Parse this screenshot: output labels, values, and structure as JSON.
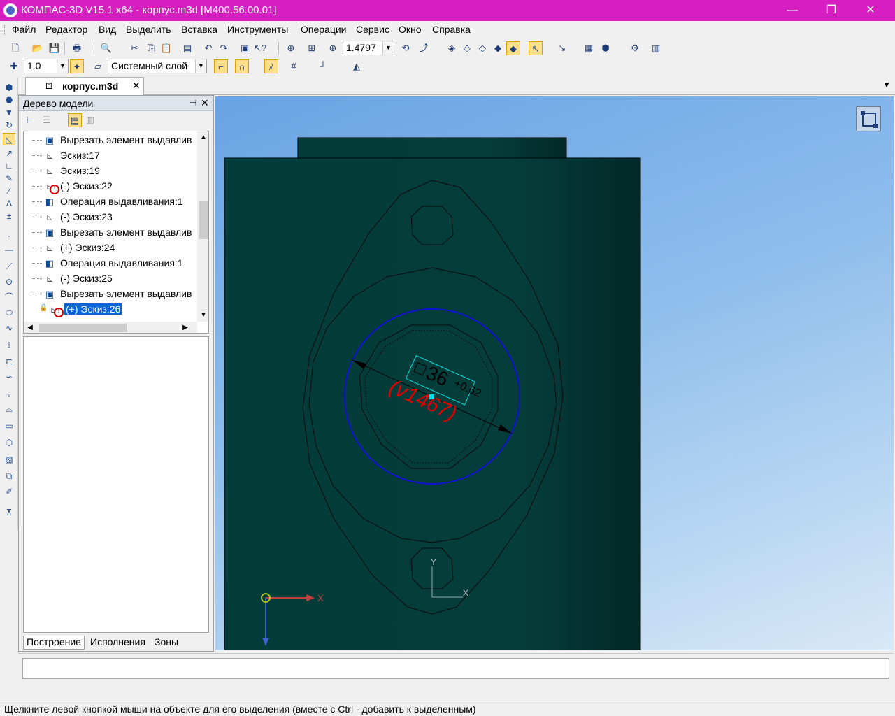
{
  "window": {
    "title": "КОМПАС-3D V15.1 x64 - корпус.m3d [М400.56.00.01]",
    "minimize": "—",
    "maximize": "❐",
    "close": "✕"
  },
  "menu": [
    "Файл",
    "Редактор",
    "Вид",
    "Выделить",
    "Вставка",
    "Инструменты",
    "Операции",
    "Сервис",
    "Окно",
    "Справка"
  ],
  "toolbar": {
    "zoom_value": "1.4797",
    "step_value": "1.0",
    "layer_value": "Системный слой"
  },
  "document_tab": {
    "label": "корпус.m3d",
    "close": "✕"
  },
  "tree_panel": {
    "title": "Дерево модели",
    "pin": "⊣",
    "close": "✕",
    "items": [
      {
        "label": "Вырезать элемент выдавливания:",
        "kind": "op",
        "error": false
      },
      {
        "label": "Эскиз:17",
        "kind": "sketch",
        "error": false
      },
      {
        "label": "Эскиз:19",
        "kind": "sketch",
        "error": false
      },
      {
        "label": "(-) Эскиз:22",
        "kind": "sketch",
        "error": true
      },
      {
        "label": "Операция выдавливания:1",
        "kind": "op",
        "error": false
      },
      {
        "label": "(-) Эскиз:23",
        "kind": "sketch",
        "error": false
      },
      {
        "label": "Вырезать элемент выдавливания:",
        "kind": "op",
        "error": false
      },
      {
        "label": "(+) Эскиз:24",
        "kind": "sketch",
        "error": false
      },
      {
        "label": "Операция выдавливания:1",
        "kind": "op",
        "error": false
      },
      {
        "label": "(-) Эскиз:25",
        "kind": "sketch",
        "error": false
      },
      {
        "label": "Вырезать элемент выдавливания:",
        "kind": "op",
        "error": false
      },
      {
        "label": "(+) Эскиз:26",
        "kind": "sketch",
        "error": true,
        "selected": true
      }
    ],
    "tabs": [
      "Построение",
      "Исполнения",
      "Зоны"
    ]
  },
  "viewport": {
    "dimension_value": "36",
    "tolerance": "+0.62",
    "variable": "(v1467)",
    "axis_x": "X",
    "axis_y": "Y",
    "local_axis_x": "X",
    "local_axis_y": "Y",
    "colors": {
      "body": "#043c3a",
      "dimension_circle": "#1010d0",
      "variable_text": "#e00000",
      "highlight": "#00e0e0"
    }
  },
  "status": {
    "text": "Щелкните левой кнопкой мыши на объекте для его выделения (вместе с Ctrl - добавить к выделенным)"
  }
}
